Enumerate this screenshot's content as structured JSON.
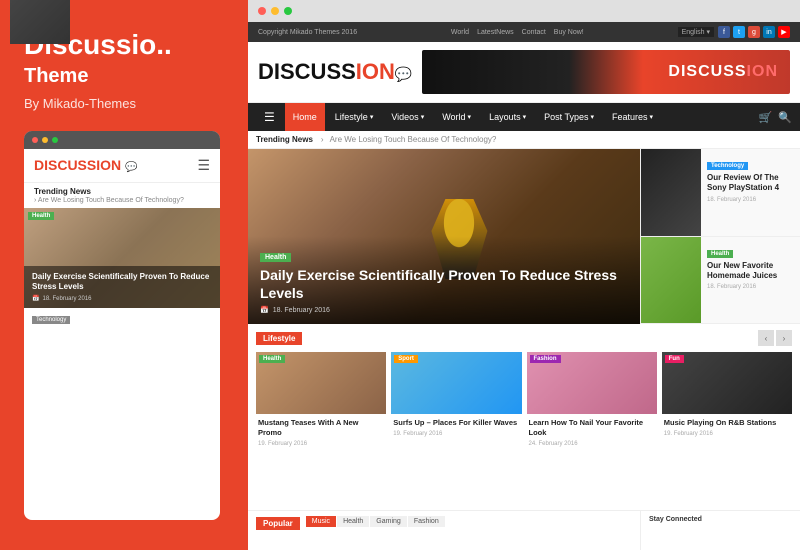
{
  "leftPanel": {
    "title": "Discussio..",
    "subtitle": "Theme",
    "by": "By Mikado-Themes",
    "mobileDots": [
      "red",
      "yellow",
      "green"
    ],
    "mobileLogoText": "DISCUSS",
    "mobileLogoAccent": "ION",
    "mobileTrending": "Trending News",
    "mobileTrendingArrow": "›",
    "mobileTrendingSubtext": "Are We Losing Touch Because Of Technology?",
    "mobileBadge": "Health",
    "mobileArticleTitle": "Daily Exercise Scientifically Proven To Reduce Stress Levels",
    "mobileArticleDate": "18. February 2016",
    "mobileTechBadge": "Technology"
  },
  "browserDots": [
    "red",
    "yellow",
    "green"
  ],
  "topbar": {
    "copyright": "Copyright Mikado Themes 2016",
    "navItems": [
      "World",
      "LatestNews",
      "Contact",
      "Buy Now!"
    ],
    "lang": "English ▾",
    "socialIcons": [
      "f",
      "t",
      "g+",
      "in",
      "▶"
    ]
  },
  "header": {
    "logoText": "DISCUSS",
    "logoAccent": "ION",
    "bannerLogoText": "DISCUSS",
    "bannerLogoAccent": "ON",
    "bannerSize": "336x61"
  },
  "nav": {
    "items": [
      {
        "label": "Home",
        "active": true
      },
      {
        "label": "Lifestyle",
        "hasArrow": true
      },
      {
        "label": "Videos",
        "hasArrow": true
      },
      {
        "label": "World",
        "hasArrow": true
      },
      {
        "label": "Layouts",
        "hasArrow": true
      },
      {
        "label": "Post Types",
        "hasArrow": true
      },
      {
        "label": "Features",
        "hasArrow": true
      }
    ]
  },
  "trending": {
    "label": "Trending News",
    "separator": "›",
    "text": "Are We Losing Touch Because Of Technology?"
  },
  "featured": {
    "badge": "Health",
    "title": "Daily Exercise Scientifically Proven To Reduce Stress Levels",
    "date": "18. February 2016",
    "sidebarArticles": [
      {
        "badge": "Technology",
        "badgeType": "tech",
        "title": "Our Review Of The Sony PlayStation 4",
        "date": "18. February 2016"
      },
      {
        "badge": "Health",
        "badgeType": "health",
        "title": "Our New Favorite Homemade Juices",
        "date": "18. February 2016"
      }
    ]
  },
  "lifestyle": {
    "sectionLabel": "Lifestyle",
    "cards": [
      {
        "badge": "Health",
        "badgeType": "health",
        "title": "Mustang Teases With A New Promo",
        "date": "19. February 2016"
      },
      {
        "badge": "Sport",
        "badgeType": "sport",
        "title": "Surfs Up – Places For Killer Waves",
        "date": "19. February 2016"
      },
      {
        "badge": "Fashion",
        "badgeType": "fashion",
        "title": "Learn How To Nail Your Favorite Look",
        "date": "24. February 2016"
      },
      {
        "badge": "Fun",
        "badgeType": "fun",
        "title": "Music Playing On R&B Stations",
        "date": "19. February 2016"
      }
    ]
  },
  "bottom": {
    "popularLabel": "Popular",
    "tabs": [
      "Music",
      "Health",
      "Gaming",
      "Fashion"
    ],
    "activeTab": "Music",
    "stayConnected": "Stay Connected"
  },
  "colors": {
    "accent": "#e8442a",
    "navBg": "#222222",
    "health": "#4caf50",
    "tech": "#2196F3",
    "sport": "#ff9800",
    "fashion": "#9c27b0",
    "fun": "#e91e63"
  }
}
